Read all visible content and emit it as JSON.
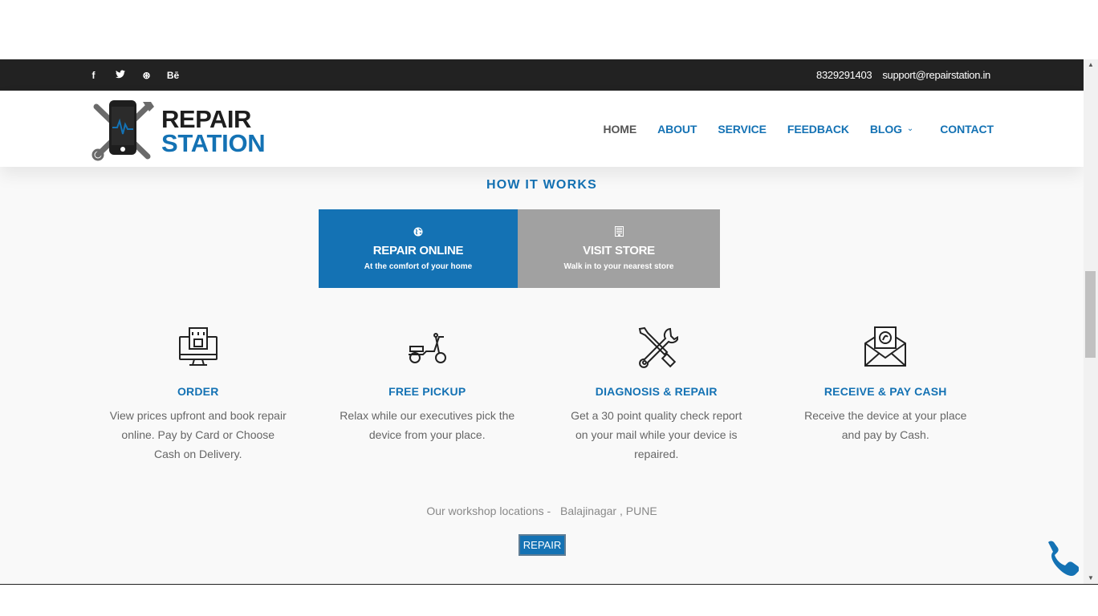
{
  "topbar": {
    "social": [
      {
        "icon": "facebook-icon",
        "glyph": "f"
      },
      {
        "icon": "twitter-icon",
        "glyph": "🐦"
      },
      {
        "icon": "dribbble-icon",
        "glyph": "⊛"
      },
      {
        "icon": "behance-icon",
        "glyph": "Bē"
      }
    ],
    "phone": "8329291403",
    "email": "support@repairstation.in"
  },
  "logo": {
    "line1": "REPAIR",
    "line2": "STATION"
  },
  "nav": {
    "items": [
      "HOME",
      "ABOUT",
      "SERVICE",
      "FEEDBACK",
      "BLOG",
      "CONTACT"
    ]
  },
  "section": {
    "title": "HOW IT WORKS"
  },
  "tabs": [
    {
      "title": "REPAIR ONLINE",
      "subtitle": "At the comfort of your home",
      "icon": "globe-icon"
    },
    {
      "title": "VISIT STORE",
      "subtitle": "Walk in to your nearest store",
      "icon": "building-icon"
    }
  ],
  "steps": [
    {
      "title": "ORDER",
      "desc": "View prices upfront and book repair online. Pay by Card or Choose Cash on Delivery.",
      "icon": "monitor-order-icon"
    },
    {
      "title": "FREE PICKUP",
      "desc": "Relax while our executives pick the device from your place.",
      "icon": "scooter-icon"
    },
    {
      "title": "DIAGNOSIS & REPAIR",
      "desc": "Get a 30 point quality check report on your mail while your device is repaired.",
      "icon": "tools-icon"
    },
    {
      "title": "RECEIVE & PAY CASH",
      "desc": "Receive the device at your place and pay by Cash.",
      "icon": "cash-envelope-icon"
    }
  ],
  "locations": {
    "label": "Our workshop locations -",
    "place": "Balajinagar , PUNE"
  },
  "cta": {
    "label": "REPAIR"
  },
  "colors": {
    "accent": "#1472b4",
    "topbar": "#222222",
    "tab_inactive": "#a1a1a1"
  }
}
